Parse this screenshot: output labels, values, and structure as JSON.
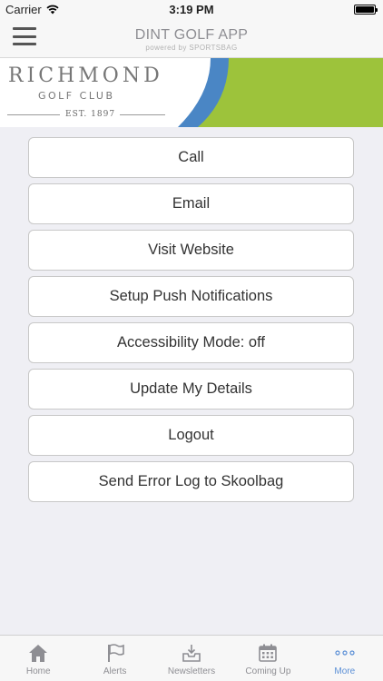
{
  "status_bar": {
    "carrier": "Carrier",
    "time": "3:19 PM"
  },
  "nav": {
    "title": "DINT GOLF APP",
    "subtitle": "powered by SPORTSBAG",
    "menu_icon": "hamburger-icon"
  },
  "banner": {
    "club_name": "RICHMOND",
    "club_sub": "GOLF CLUB",
    "est": "EST. 1897",
    "colors": {
      "green": "#9dc33b",
      "blue": "#4a86c5"
    }
  },
  "menu": [
    {
      "label": "Call"
    },
    {
      "label": "Email"
    },
    {
      "label": "Visit Website"
    },
    {
      "label": "Setup Push Notifications"
    },
    {
      "label": "Accessibility Mode: off"
    },
    {
      "label": "Update My Details"
    },
    {
      "label": "Logout"
    },
    {
      "label": "Send Error Log to Skoolbag"
    }
  ],
  "tabs": [
    {
      "label": "Home",
      "icon": "home-icon"
    },
    {
      "label": "Alerts",
      "icon": "flag-icon"
    },
    {
      "label": "Newsletters",
      "icon": "inbox-icon"
    },
    {
      "label": "Coming Up",
      "icon": "calendar-icon"
    },
    {
      "label": "More",
      "icon": "more-icon",
      "active": true
    }
  ],
  "accent_color": "#5b8fd6"
}
